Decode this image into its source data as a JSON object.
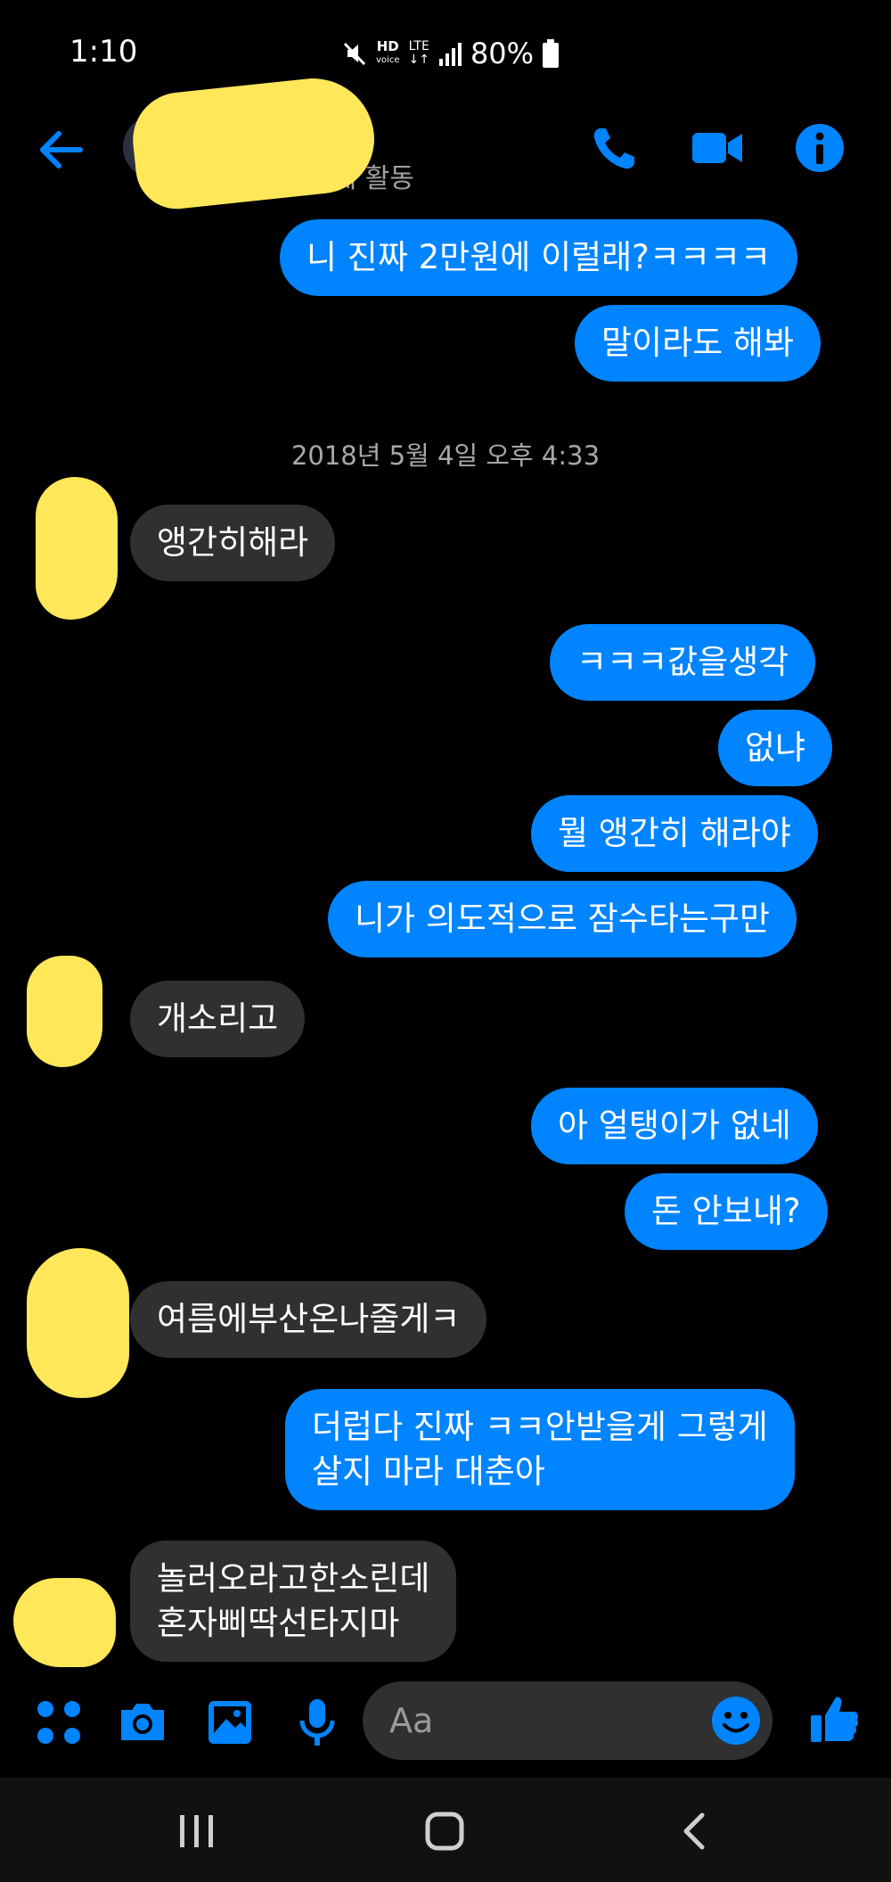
{
  "status": {
    "time": "1:10",
    "network_hd": "HD",
    "network_voice": "voice",
    "network_lte": "LTE",
    "battery": "80%"
  },
  "header": {
    "active_status": "전에 활동"
  },
  "messages": [
    {
      "side": "out",
      "text": "니 진짜 2만원에 이럴래?ㅋㅋㅋㅋ"
    },
    {
      "side": "out",
      "text": "말이라도 해봐"
    },
    {
      "side": "in",
      "text": "앵간히해라"
    },
    {
      "side": "out",
      "text": "ㅋㅋㅋ값을생각"
    },
    {
      "side": "out",
      "text": "없냐"
    },
    {
      "side": "out",
      "text": "뭘 앵간히 해라야"
    },
    {
      "side": "out",
      "text": "니가 의도적으로 잠수타는구만"
    },
    {
      "side": "in",
      "text": "개소리고"
    },
    {
      "side": "out",
      "text": "아 얼탱이가 없네"
    },
    {
      "side": "out",
      "text": "돈 안보내?"
    },
    {
      "side": "in",
      "text": "여름에부산온나줄게ㅋ"
    },
    {
      "side": "out",
      "text": "더럽다 진짜 ㅋㅋ안받을게 그렇게\n살지 마라 대춘아"
    },
    {
      "side": "in",
      "text": "놀러오라고한소린데\n혼자삐딱선타지마"
    }
  ],
  "timestamp": "2018년 5월 4일 오후 4:33",
  "composer": {
    "placeholder": "Aa"
  },
  "colors": {
    "accent": "#0084ff",
    "incoming_bubble": "#303030",
    "background": "#000000"
  },
  "icons": {
    "header": [
      "back-arrow-icon",
      "phone-icon",
      "video-camera-icon",
      "info-icon"
    ],
    "composer": [
      "apps-grid-icon",
      "camera-icon",
      "gallery-icon",
      "microphone-icon",
      "emoji-icon",
      "thumbs-up-icon"
    ],
    "nav": [
      "recents-icon",
      "home-icon",
      "back-chevron-icon"
    ]
  }
}
